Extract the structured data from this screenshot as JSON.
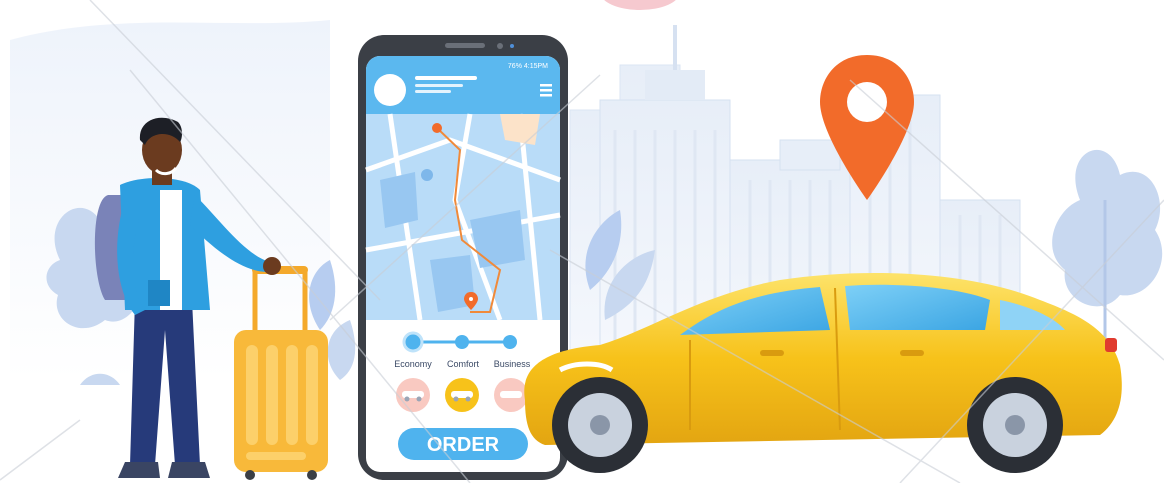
{
  "phone": {
    "status_bar": "76% 4:15PM",
    "tiers": [
      {
        "label": "Economy",
        "car_icon": "car-icon"
      },
      {
        "label": "Comfort",
        "car_icon": "car-icon"
      },
      {
        "label": "Business",
        "car_icon": "car-icon"
      }
    ],
    "order_label": "ORDER"
  },
  "colors": {
    "sky_blue": "#5bb8ef",
    "map_blue": "#a9d4f7",
    "taxi_yellow": "#f7c21a",
    "pin_orange": "#f26b2a",
    "jacket_blue": "#2e9fe0",
    "luggage_yellow": "#f8b93a",
    "city_pale": "#dfeaf7"
  },
  "icons": {
    "location_pin": "location-pin-icon",
    "menu": "hamburger-menu-icon"
  }
}
